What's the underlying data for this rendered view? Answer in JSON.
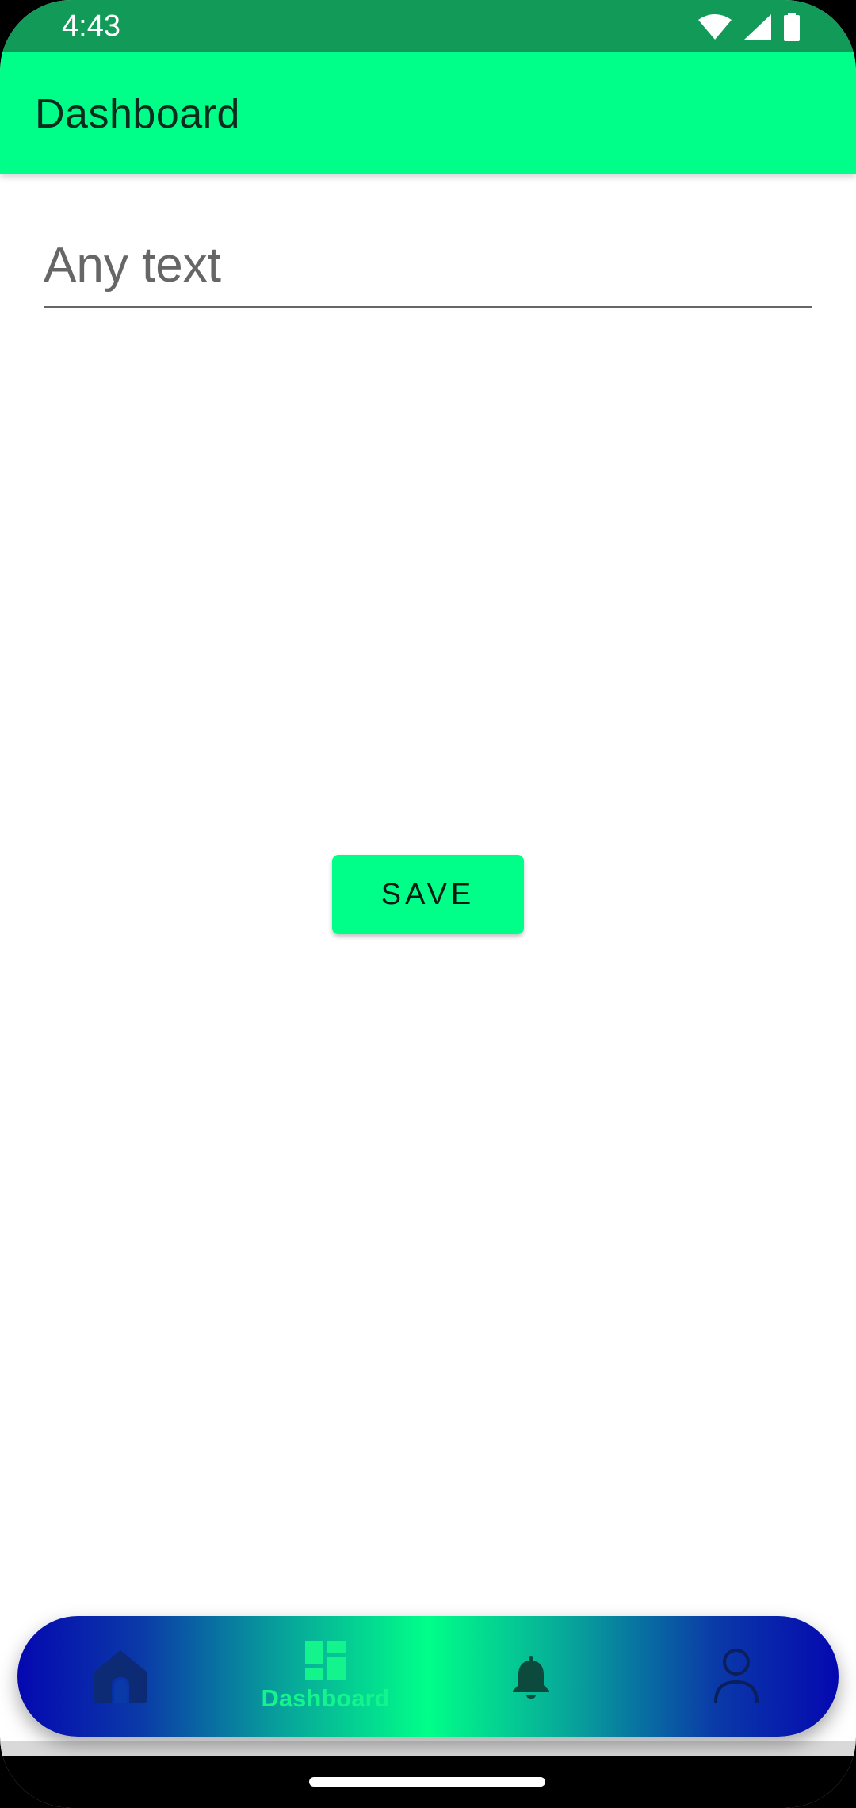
{
  "status_bar": {
    "time": "4:43",
    "icons": [
      "wifi-icon",
      "cellular-signal-icon",
      "battery-icon"
    ]
  },
  "app_bar": {
    "title": "Dashboard"
  },
  "form": {
    "text_input_placeholder": "Any text",
    "text_input_value": ""
  },
  "save_button": {
    "label": "SAVE"
  },
  "bottom_nav": {
    "items": [
      {
        "id": "home",
        "icon": "home-icon",
        "label": "",
        "selected": false
      },
      {
        "id": "dashboard",
        "icon": "dashboard-icon",
        "label": "Dashboard",
        "selected": true
      },
      {
        "id": "notifications",
        "icon": "bell-icon",
        "label": "",
        "selected": false
      },
      {
        "id": "profile",
        "icon": "person-icon",
        "label": "",
        "selected": false
      }
    ]
  },
  "colors": {
    "status_bar": "#129a58",
    "app_bar": "#00ff89",
    "accent": "#00ff89",
    "nav_gradient_edge": "#0508b0",
    "nav_gradient_center": "#00ff89"
  }
}
